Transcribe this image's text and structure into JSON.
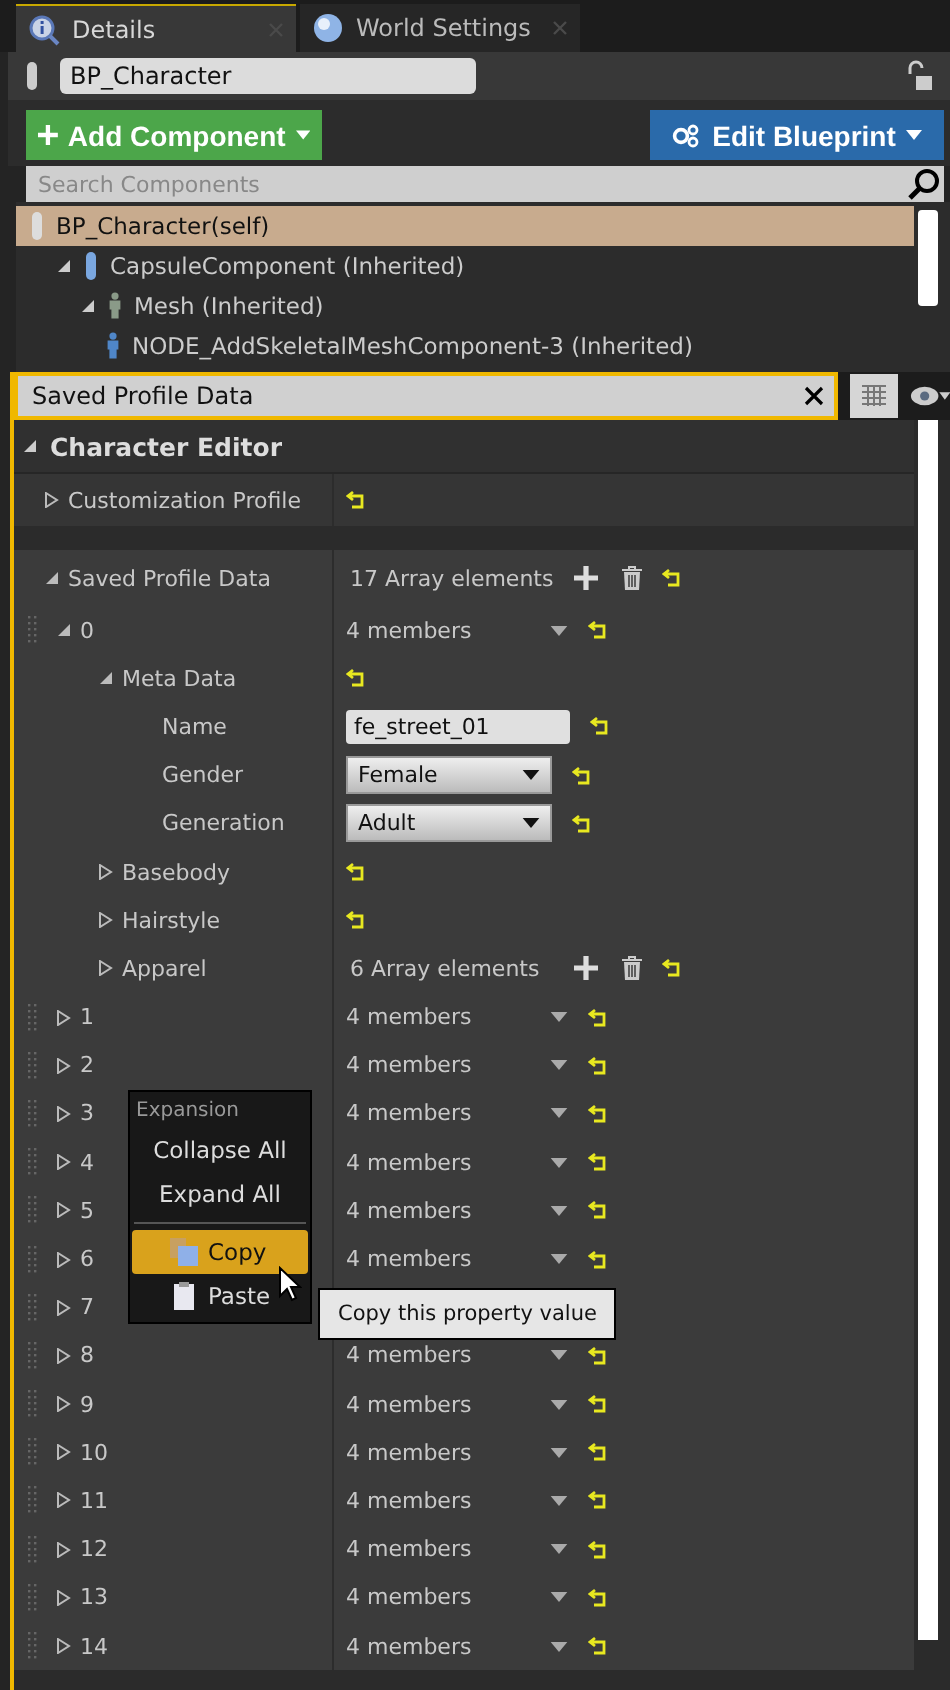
{
  "tabs": [
    {
      "label": "Details",
      "kind": "details",
      "selected": true
    },
    {
      "label": "World Settings",
      "kind": "world",
      "selected": false
    }
  ],
  "actor": {
    "name": "BP_Character"
  },
  "add_component_button": "Add Component",
  "edit_blueprint_button": "Edit Blueprint",
  "component_search": {
    "placeholder": "Search Components"
  },
  "components": [
    {
      "label": "BP_Character(self)",
      "kind": "actor",
      "selected": true,
      "children": [
        {
          "label": "CapsuleComponent (Inherited)",
          "kind": "capsule",
          "selected": false,
          "expanded": true,
          "children": [
            {
              "label": "Mesh (Inherited)",
              "kind": "mesh",
              "selected": false,
              "expanded": true,
              "children": [
                {
                  "label": "NODE_AddSkeletalMeshComponent-3 (Inherited)",
                  "kind": "skeletal",
                  "selected": false
                }
              ]
            }
          ]
        }
      ]
    }
  ],
  "details_search": {
    "value": "Saved Profile Data"
  },
  "category": {
    "title": "Character Editor",
    "expanded": true
  },
  "properties": [
    {
      "name": "Customization Profile",
      "kind": "struct",
      "expanded": false
    },
    {
      "name": "Saved Profile Data",
      "kind": "array",
      "value": "17 Array elements",
      "expanded": true,
      "children": [
        {
          "name": "0",
          "kind": "element",
          "value": "4 members",
          "expanded": true,
          "children": [
            {
              "name": "Meta Data",
              "kind": "struct",
              "expanded": true,
              "children": [
                {
                  "name": "Name",
                  "kind": "text",
                  "value": "fe_street_01"
                },
                {
                  "name": "Gender",
                  "kind": "combo",
                  "value": "Female"
                },
                {
                  "name": "Generation",
                  "kind": "combo",
                  "value": "Adult"
                }
              ]
            },
            {
              "name": "Basebody",
              "kind": "struct",
              "expanded": false
            },
            {
              "name": "Hairstyle",
              "kind": "struct",
              "expanded": false
            },
            {
              "name": "Apparel",
              "kind": "array",
              "value": "6 Array elements",
              "expanded": false
            }
          ]
        },
        {
          "name": "1",
          "kind": "element",
          "value": "4 members",
          "expanded": false
        },
        {
          "name": "2",
          "kind": "element",
          "value": "4 members",
          "expanded": false
        },
        {
          "name": "3",
          "kind": "element",
          "value": "4 members",
          "expanded": false
        },
        {
          "name": "4",
          "kind": "element",
          "value": "4 members",
          "expanded": false
        },
        {
          "name": "5",
          "kind": "element",
          "value": "4 members",
          "expanded": false
        },
        {
          "name": "6",
          "kind": "element",
          "value": "4 members",
          "expanded": false
        },
        {
          "name": "7",
          "kind": "element",
          "expanded": false
        },
        {
          "name": "8",
          "kind": "element",
          "value": "4 members",
          "expanded": false
        },
        {
          "name": "9",
          "kind": "element",
          "value": "4 members",
          "expanded": false
        },
        {
          "name": "10",
          "kind": "element",
          "value": "4 members",
          "expanded": false
        },
        {
          "name": "11",
          "kind": "element",
          "value": "4 members",
          "expanded": false
        },
        {
          "name": "12",
          "kind": "element",
          "value": "4 members",
          "expanded": false
        },
        {
          "name": "13",
          "kind": "element",
          "value": "4 members",
          "expanded": false
        },
        {
          "name": "14",
          "kind": "element",
          "value": "4 members",
          "expanded": false
        }
      ]
    }
  ],
  "context_menu": {
    "sections": [
      {
        "heading": "Expansion",
        "items": [
          {
            "label": "Collapse All",
            "kind": "plain",
            "selected": false
          },
          {
            "label": "Expand All",
            "kind": "plain",
            "selected": false
          }
        ]
      },
      {
        "items": [
          {
            "label": "Copy",
            "kind": "copy",
            "selected": true
          },
          {
            "label": "Paste",
            "kind": "paste",
            "selected": false
          }
        ]
      }
    ]
  },
  "tooltip": "Copy this property value"
}
